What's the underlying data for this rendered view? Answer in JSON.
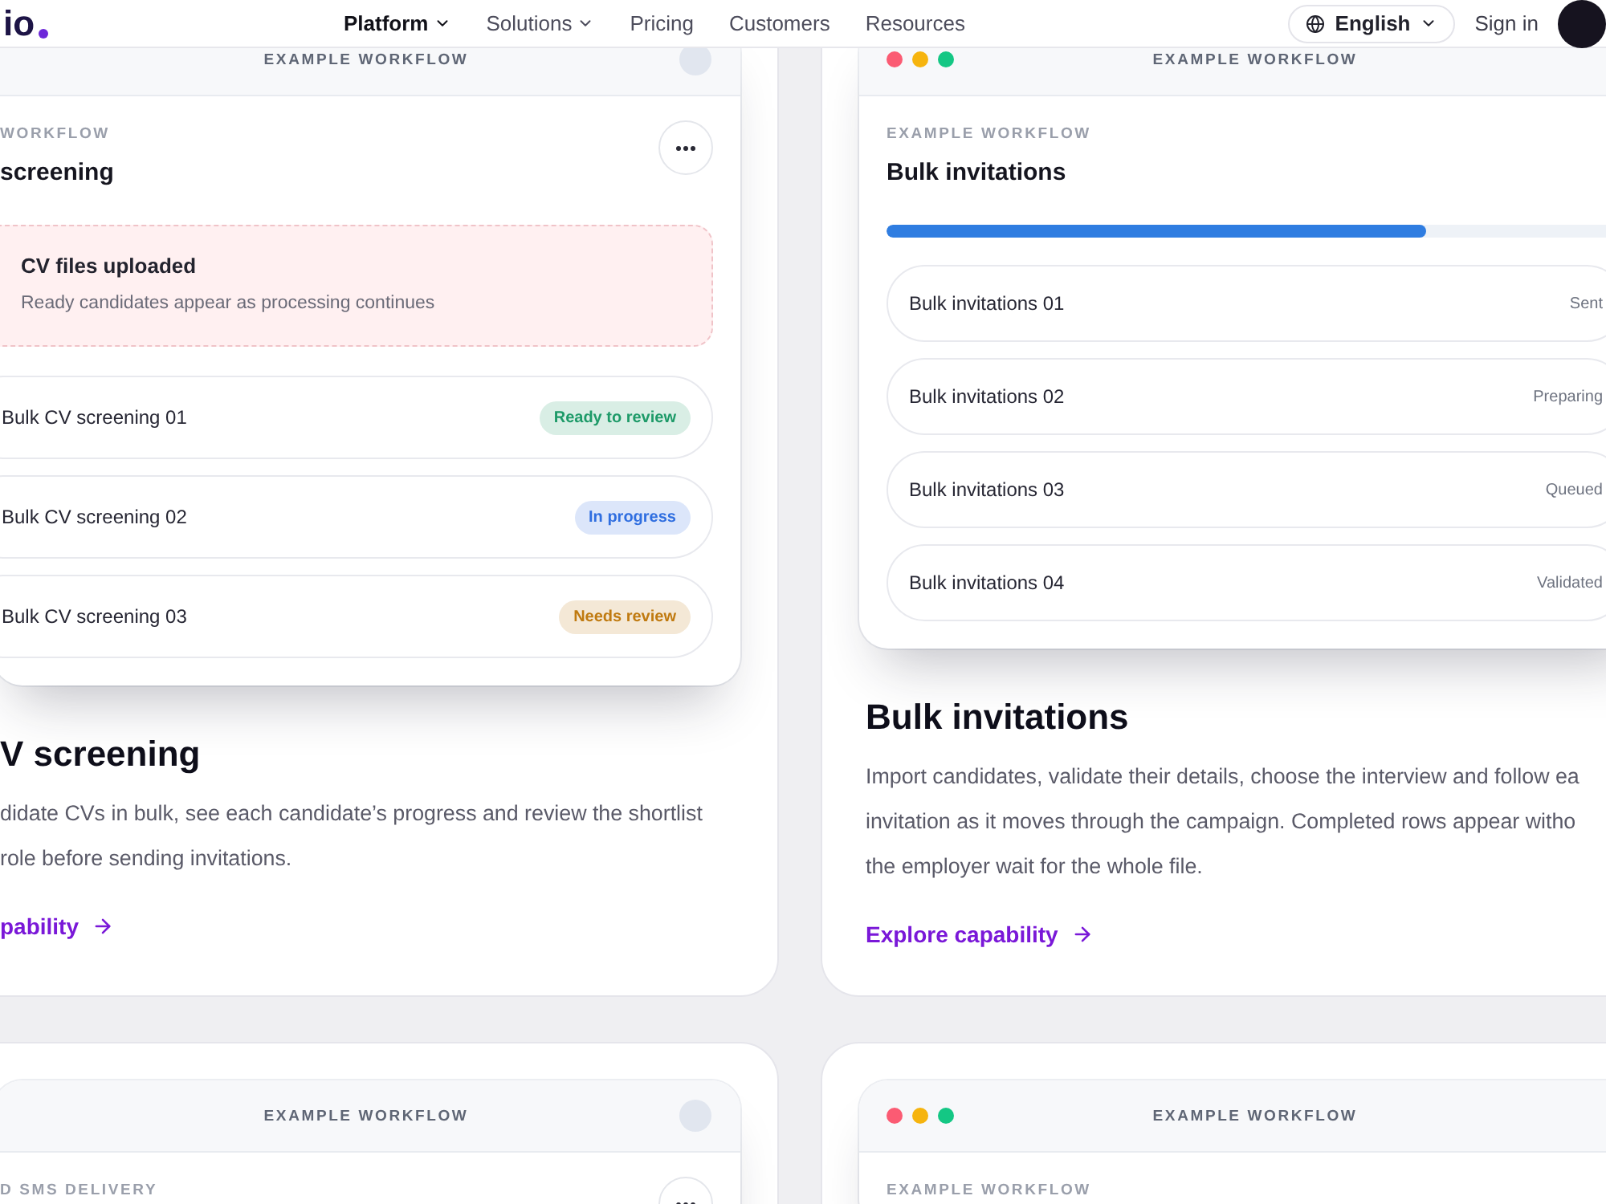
{
  "nav": {
    "logo": "io",
    "links": [
      {
        "label": "Platform",
        "selected": true,
        "dropdown": true
      },
      {
        "label": "Solutions",
        "selected": false,
        "dropdown": true
      },
      {
        "label": "Pricing",
        "selected": false,
        "dropdown": false
      },
      {
        "label": "Customers",
        "selected": false,
        "dropdown": false
      },
      {
        "label": "Resources",
        "selected": false,
        "dropdown": false
      }
    ],
    "language": "English",
    "sign_in": "Sign in"
  },
  "cards": [
    {
      "window": {
        "header_label": "EXAMPLE WORKFLOW",
        "dots": false,
        "corner_circle": true,
        "label": "WORKFLOW",
        "title": "screening",
        "menu_button": true,
        "notice": {
          "title": "CV files uploaded",
          "text": "Ready candidates appear as processing continues"
        },
        "rows": [
          {
            "kind": "badge",
            "label": "Bulk CV screening 01",
            "status": "Ready to review",
            "color": "#1d9a68"
          },
          {
            "kind": "badge",
            "label": "Bulk CV screening 02",
            "status": "In progress",
            "color": "#2f6ee0"
          },
          {
            "kind": "badge",
            "label": "Bulk CV screening 03",
            "status": "Needs review",
            "color": "#c07a10"
          }
        ]
      },
      "heading": "V screening",
      "description": "didate CVs in bulk, see each candidate’s progress and review the shortlist\nrole before sending invitations.",
      "link": "pability"
    },
    {
      "window": {
        "header_label": "EXAMPLE WORKFLOW",
        "dots": true,
        "corner_circle": false,
        "label": "EXAMPLE WORKFLOW",
        "title": "Bulk invitations",
        "menu_button": false,
        "progress": {
          "level": 0.73
        },
        "rows": [
          {
            "kind": "text",
            "label": "Bulk invitations 01",
            "status": "Sent"
          },
          {
            "kind": "text",
            "label": "Bulk invitations 02",
            "status": "Preparing"
          },
          {
            "kind": "text",
            "label": "Bulk invitations 03",
            "status": "Queued"
          },
          {
            "kind": "text",
            "label": "Bulk invitations 04",
            "status": "Validated"
          }
        ]
      },
      "heading": "Bulk invitations",
      "description": "Import candidates, validate their details, choose the interview and follow ea\ninvitation as it moves through the campaign. Completed rows appear witho\nthe employer wait for the whole file.",
      "link": "Explore capability"
    },
    {
      "window": {
        "header_label": "EXAMPLE WORKFLOW",
        "dots": false,
        "corner_circle": true,
        "label": "D SMS DELIVERY",
        "menu_button": true
      }
    },
    {
      "window": {
        "header_label": "EXAMPLE WORKFLOW",
        "dots": true,
        "corner_circle": false,
        "label": "EXAMPLE WORKFLOW",
        "menu_button": false
      }
    }
  ]
}
